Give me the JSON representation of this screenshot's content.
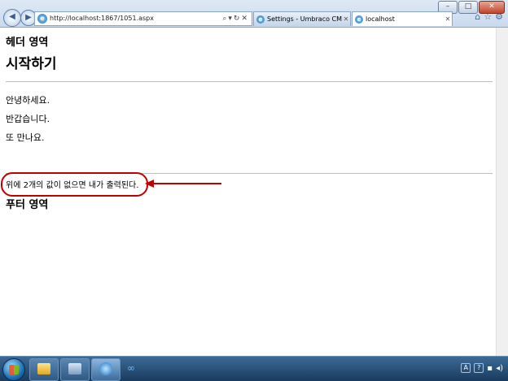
{
  "browser": {
    "address": "http://localhost:1867/1051.aspx",
    "tabs": [
      {
        "label": "Settings - Umbraco CMS - ..."
      },
      {
        "label": "localhost"
      }
    ]
  },
  "page": {
    "header_text": "헤더 영역",
    "title": "시작하기",
    "lines": [
      "안녕하세요.",
      "반갑습니다.",
      "또 만나요."
    ],
    "fallback_text": "위에 2개의 값이 없으면 내가 출력된다.",
    "footer_text": "푸터 영역"
  },
  "colors": {
    "annotation": "#c00000"
  }
}
